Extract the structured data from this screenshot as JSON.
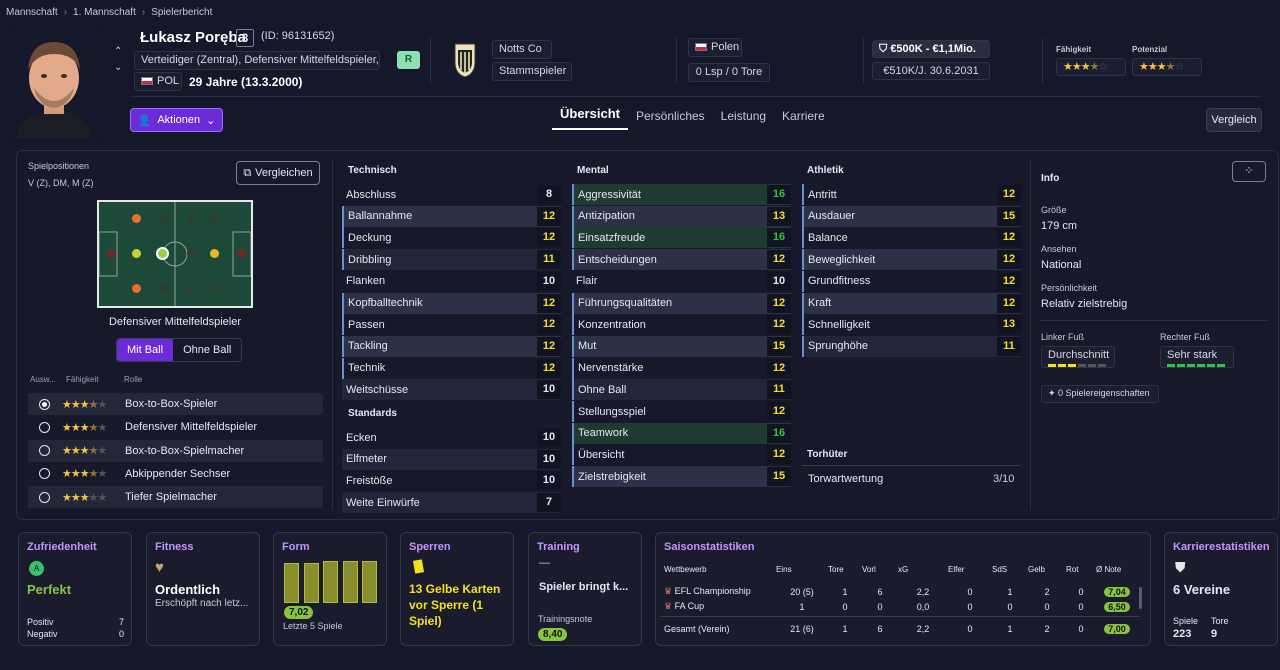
{
  "breadcrumb": [
    "Mannschaft",
    "1. Mannschaft",
    "Spielerbericht"
  ],
  "player": {
    "name": "Łukasz Poręba",
    "number": "3",
    "id": "(ID: 96131652)",
    "positions": "Verteidiger (Zentral), Defensiver Mittelfeldspieler, ...",
    "nationality": "POL",
    "age": "29 Jahre (13.3.2000)",
    "badge": "R"
  },
  "club": {
    "name": "Notts Co",
    "status": "Stammspieler"
  },
  "country": {
    "name": "Polen",
    "caps": "0 Lsp / 0 Tore"
  },
  "value": {
    "range": "€500K - €1,1Mio.",
    "contract": "€510K/J. 30.6.2031"
  },
  "ratings": {
    "ability_label": "Fähigkeit",
    "potential_label": "Potenzial",
    "ability_stars": 3.5,
    "potential_stars": 3.5
  },
  "actions_label": "Aktionen",
  "tabs": [
    "Übersicht",
    "Persönliches",
    "Leistung",
    "Karriere"
  ],
  "compare_label": "Vergleich",
  "positions_panel": {
    "title": "Spielpositionen",
    "list": "V (Z), DM, M (Z)",
    "compare_btn": "Vergleichen",
    "role": "Defensiver Mittelfeldspieler",
    "toggle": [
      "Mit Ball",
      "Ohne Ball"
    ],
    "cols": [
      "Ausw...",
      "Fähigkeit",
      "Rolle"
    ],
    "roles": [
      {
        "name": "Box-to-Box-Spieler",
        "stars": 3.5,
        "selected": true
      },
      {
        "name": "Defensiver Mittelfeldspieler",
        "stars": 3.5,
        "selected": false
      },
      {
        "name": "Box-to-Box-Spielmacher",
        "stars": 3.5,
        "selected": false
      },
      {
        "name": "Abkippender Sechser",
        "stars": 3.5,
        "selected": false
      },
      {
        "name": "Tiefer Spielmacher",
        "stars": 3,
        "selected": false
      }
    ]
  },
  "technical": {
    "title": "Technisch",
    "attrs": [
      [
        "Abschluss",
        "8"
      ],
      [
        "Ballannahme",
        "12"
      ],
      [
        "Deckung",
        "12"
      ],
      [
        "Dribbling",
        "11"
      ],
      [
        "Flanken",
        "10"
      ],
      [
        "Kopfballtechnik",
        "12"
      ],
      [
        "Passen",
        "12"
      ],
      [
        "Tackling",
        "12"
      ],
      [
        "Technik",
        "12"
      ],
      [
        "Weitschüsse",
        "10"
      ]
    ]
  },
  "standards": {
    "title": "Standards",
    "attrs": [
      [
        "Ecken",
        "10"
      ],
      [
        "Elfmeter",
        "10"
      ],
      [
        "Freistöße",
        "10"
      ],
      [
        "Weite Einwürfe",
        "7"
      ]
    ]
  },
  "mental": {
    "title": "Mental",
    "attrs": [
      [
        "Aggressivität",
        "16"
      ],
      [
        "Antizipation",
        "13"
      ],
      [
        "Einsatzfreude",
        "16"
      ],
      [
        "Entscheidungen",
        "12"
      ],
      [
        "Flair",
        "10"
      ],
      [
        "Führungsqualitäten",
        "12"
      ],
      [
        "Konzentration",
        "12"
      ],
      [
        "Mut",
        "15"
      ],
      [
        "Nervenstärke",
        "12"
      ],
      [
        "Ohne Ball",
        "11"
      ],
      [
        "Stellungsspiel",
        "12"
      ],
      [
        "Teamwork",
        "16"
      ],
      [
        "Übersicht",
        "12"
      ],
      [
        "Zielstrebigkeit",
        "15"
      ]
    ]
  },
  "athletic": {
    "title": "Athletik",
    "attrs": [
      [
        "Antritt",
        "12"
      ],
      [
        "Ausdauer",
        "15"
      ],
      [
        "Balance",
        "12"
      ],
      [
        "Beweglichkeit",
        "12"
      ],
      [
        "Grundfitness",
        "12"
      ],
      [
        "Kraft",
        "12"
      ],
      [
        "Schnelligkeit",
        "13"
      ],
      [
        "Sprunghöhe",
        "11"
      ]
    ]
  },
  "goalkeeper": {
    "title": "Torhüter",
    "label": "Torwartwertung",
    "value": "3/10"
  },
  "info": {
    "title": "Info",
    "height_label": "Größe",
    "height": "179 cm",
    "rep_label": "Ansehen",
    "rep": "National",
    "pers_label": "Persönlichkeit",
    "pers": "Relativ zielstrebig",
    "left_label": "Linker Fuß",
    "left": "Durchschnitt",
    "right_label": "Rechter Fuß",
    "right": "Sehr stark",
    "traits": "0 Spielereigenschaften"
  },
  "cards": {
    "satisfaction": {
      "title": "Zufriedenheit",
      "value": "Perfekt",
      "pos_label": "Positiv",
      "pos": "7",
      "neg_label": "Negativ",
      "neg": "0"
    },
    "fitness": {
      "title": "Fitness",
      "value": "Ordentlich",
      "sub": "Erschöpft nach letz..."
    },
    "form": {
      "title": "Form",
      "rating": "7,02",
      "sub": "Letzte 5 Spiele",
      "bars": [
        0.72,
        0.72,
        0.75,
        0.75,
        0.75
      ]
    },
    "bans": {
      "title": "Sperren",
      "value": "13 Gelbe Karten vor Sperre (1 Spiel)"
    },
    "training": {
      "title": "Training",
      "dash": "—",
      "value": "Spieler bringt k...",
      "note_label": "Trainingsnote",
      "note": "8,40"
    },
    "season": {
      "title": "Saisonstatistiken",
      "headers": [
        "Wettbewerb",
        "Eins",
        "Tore",
        "Vorl",
        "xG",
        "Elfer",
        "SdS",
        "Gelb",
        "Rot",
        "Ø Note"
      ],
      "rows": [
        [
          "EFL Championship",
          "20 (5)",
          "1",
          "6",
          "2,2",
          "0",
          "1",
          "2",
          "0",
          "7,04"
        ],
        [
          "FA Cup",
          "1",
          "0",
          "0",
          "0,0",
          "0",
          "0",
          "0",
          "0",
          "6,50"
        ]
      ],
      "total": [
        "Gesamt (Verein)",
        "21 (6)",
        "1",
        "6",
        "2,2",
        "0",
        "1",
        "2",
        "0",
        "7,00"
      ]
    },
    "career": {
      "title": "Karrierestatistiken",
      "clubs": "6 Vereine",
      "games_label": "Spiele",
      "games": "223",
      "goals_label": "Tore",
      "goals": "9"
    }
  },
  "colors": {
    "accent": "#6c2bd9",
    "title_purple": "#c493ff",
    "high": "#28c840",
    "mid": "#f5e020",
    "good_pill": "#8ac43f"
  }
}
